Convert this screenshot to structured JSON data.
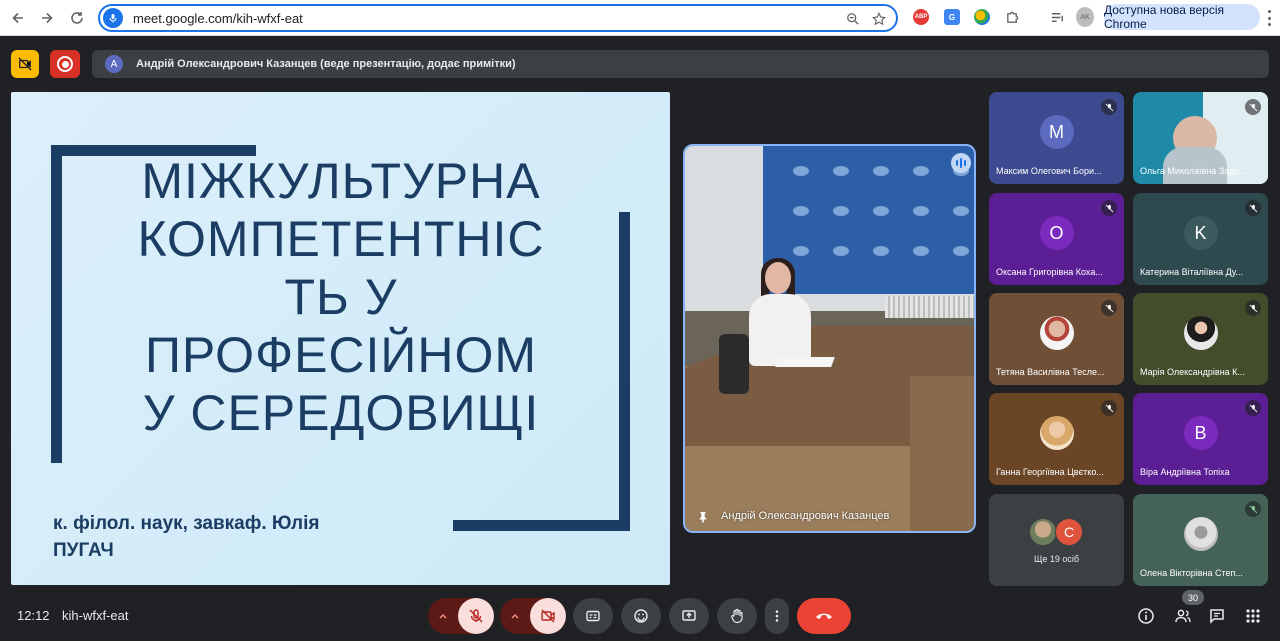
{
  "browser": {
    "url": "meet.google.com/kih-wfxf-eat",
    "update_label": "Доступна нова версія Chrome",
    "abp_label": "ABP",
    "translate_label": "G",
    "profile_label": "AK"
  },
  "meet": {
    "presenter_banner": "Андрій Олександрович Казанцев (веде презентацію, додає примітки)",
    "presenter_avatar_letter": "A",
    "clock": "12:12",
    "meeting_code": "kih-wfxf-eat",
    "people_count": "30"
  },
  "slide": {
    "title_lines": [
      "МІЖКУЛЬТУРНА",
      "КОМПЕТЕНТНІС",
      "ТЬ У",
      "ПРОФЕСІЙНОМ",
      "У СЕРЕДОВИЩІ"
    ],
    "author_line1": "к. філол. наук, завкаф. Юлія",
    "author_line2": "ПУГАЧ"
  },
  "presenter_video": {
    "name": "Андрій Олександрович Казанцев"
  },
  "participants": [
    {
      "name": "Максим Олегович Бори...",
      "initial": "M",
      "color": "#5c6bc0",
      "bg": "#3d4a8f"
    },
    {
      "name": "Ольга Миколаївна Задо...",
      "initial": "",
      "color": "#4fb0c6",
      "bg": "#1f8aa8"
    },
    {
      "name": "Оксана Григорівна Коха...",
      "initial": "O",
      "color": "#7b2cbf",
      "bg": "#5b1e94"
    },
    {
      "name": "Катерина Віталіївна Ду...",
      "initial": "K",
      "color": "#3c5a5e",
      "bg": "#2e4a4e"
    },
    {
      "name": "Тетяна Василівна Тесле...",
      "initial": "",
      "color": "#8d6748",
      "bg": "#6f4f36"
    },
    {
      "name": "Марія Олександрівна К...",
      "initial": "",
      "color": "#55613a",
      "bg": "#434d2c"
    },
    {
      "name": "Ганна Георгіївна Цвєтко...",
      "initial": "",
      "color": "#7d5530",
      "bg": "#6a4526"
    },
    {
      "name": "Віра Андріївна Топіха",
      "initial": "B",
      "color": "#7b2cbf",
      "bg": "#5b1e94"
    },
    {
      "name": "Олена Вікторівна Степ...",
      "initial": "",
      "color": "#5a7a6f",
      "bg": "#456257"
    }
  ],
  "others": {
    "letter": "C",
    "label": "Ще 19 осіб"
  }
}
